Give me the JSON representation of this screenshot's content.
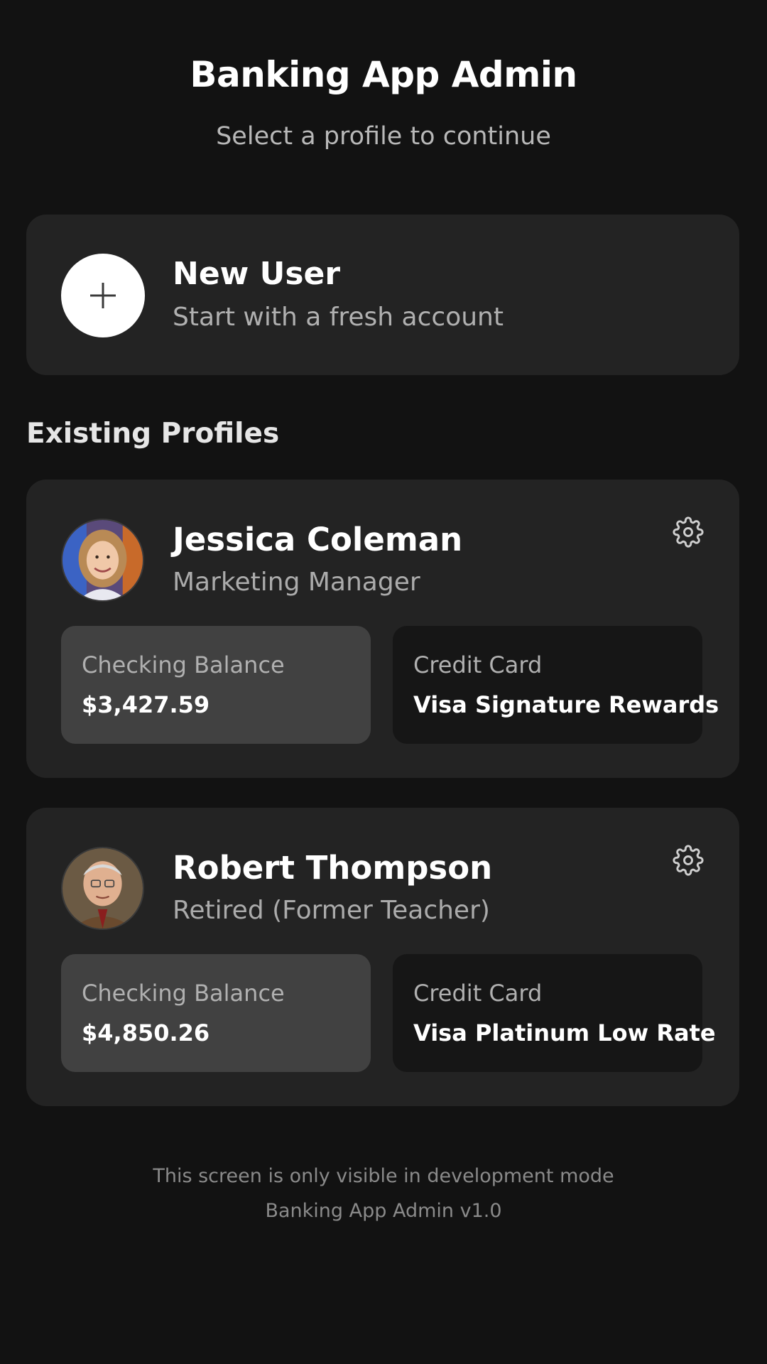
{
  "header": {
    "title": "Banking App Admin",
    "subtitle": "Select a profile to continue"
  },
  "new_user": {
    "icon": "plus-icon",
    "title": "New User",
    "subtitle": "Start with a fresh account"
  },
  "section_heading": "Existing Profiles",
  "profiles": [
    {
      "name": "Jessica Coleman",
      "role": "Marketing Manager",
      "avatar": "avatar-photo",
      "settings_icon": "gear-icon",
      "checking_label": "Checking Balance",
      "checking_value": "$3,427.59",
      "credit_label": "Credit Card",
      "credit_value": "Visa Signature Rewards"
    },
    {
      "name": "Robert Thompson",
      "role": "Retired (Former Teacher)",
      "avatar": "avatar-photo",
      "settings_icon": "gear-icon",
      "checking_label": "Checking Balance",
      "checking_value": "$4,850.26",
      "credit_label": "Credit Card",
      "credit_value": "Visa Platinum Low Rate"
    }
  ],
  "footer": {
    "line1": "This screen is only visible in development mode",
    "line2": "Banking App Admin v1.0"
  },
  "colors": {
    "background": "#121212",
    "card": "#232323",
    "checking_tile": "#414141",
    "credit_tile": "#161616",
    "text_primary": "#ffffff",
    "text_secondary": "#b0b0b0"
  }
}
